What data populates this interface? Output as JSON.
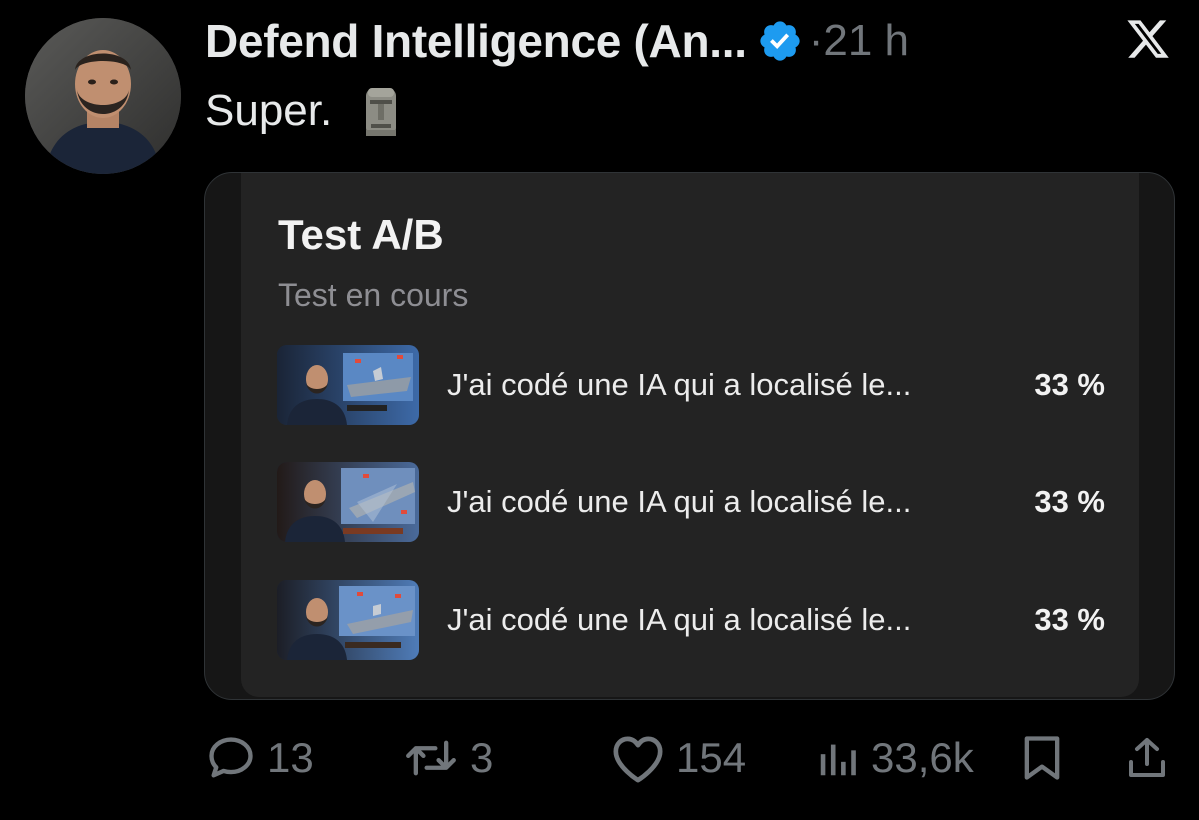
{
  "author": {
    "name": "Defend Intelligence (An...",
    "separator": "·",
    "time": "21 h",
    "verified_badge": "verified-badge-icon",
    "avatar": "profile-photo"
  },
  "platform_logo": "x-logo",
  "tweet": {
    "text": "Super.",
    "emoji": "moai-icon"
  },
  "card": {
    "title": "Test A/B",
    "subtitle": "Test en cours",
    "variants": [
      {
        "title": "J'ai codé une IA qui a localisé le...",
        "percent": "33 %"
      },
      {
        "title": "J'ai codé une IA qui a localisé le...",
        "percent": "33 %"
      },
      {
        "title": "J'ai codé une IA qui a localisé le...",
        "percent": "33 %"
      }
    ]
  },
  "actions": {
    "replies": "13",
    "reposts": "3",
    "likes": "154",
    "views": "33,6k"
  },
  "colors": {
    "background": "#000000",
    "text_primary": "#e7e9ea",
    "text_secondary": "#71767b",
    "verified_blue": "#1d9bf0",
    "card_background": "#232323"
  }
}
